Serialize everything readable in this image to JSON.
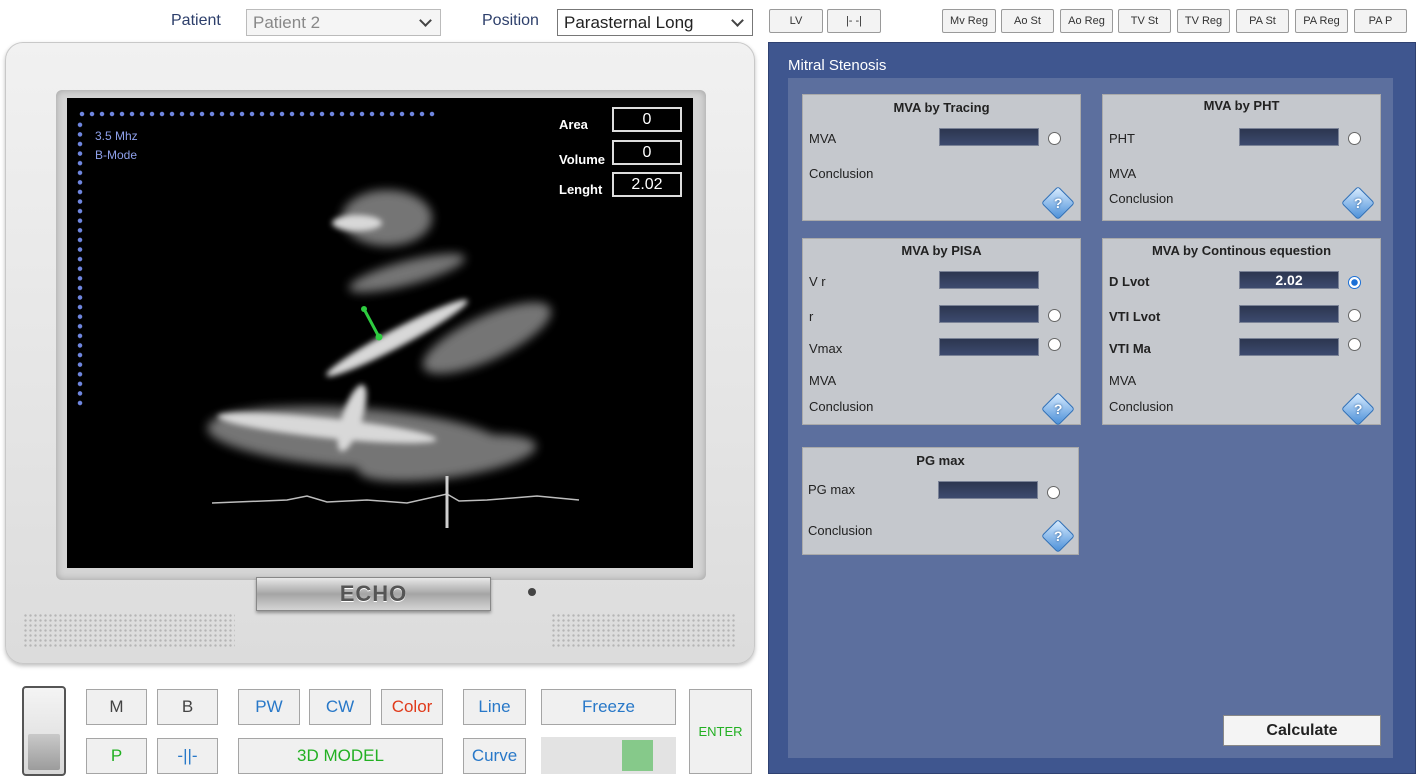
{
  "topbar": {
    "patient_label": "Patient",
    "patient_value": "Patient 2",
    "position_label": "Position",
    "position_value": "Parasternal Long",
    "view_buttons": [
      "LV",
      "|- -|"
    ],
    "mode_buttons": [
      "Mv Reg",
      "Ao St",
      "Ao Reg",
      "TV St",
      "TV Reg",
      "PA St",
      "PA Reg",
      "PA P"
    ]
  },
  "screen": {
    "freq": "3.5 Mhz",
    "mode": "B-Mode",
    "area_label": "Area",
    "area_value": "0",
    "volume_label": "Volume",
    "volume_value": "0",
    "length_label": "Lenght",
    "length_value": "2.02"
  },
  "monitor": {
    "logo": "ECHO"
  },
  "controls": {
    "m": "M",
    "b": "B",
    "pw": "PW",
    "cw": "CW",
    "color": "Color",
    "line": "Line",
    "freeze": "Freeze",
    "p": "P",
    "caliper": "-||-",
    "model3d": "3D MODEL",
    "curve": "Curve",
    "enter": "ENTER",
    "gain_level": 0.8
  },
  "panel": {
    "title": "Mitral Stenosis",
    "tracing": {
      "title": "MVA by Tracing",
      "mva": "MVA",
      "conclusion": "Conclusion"
    },
    "pht": {
      "title": "MVA by PHT",
      "pht": "PHT",
      "mva": "MVA",
      "conclusion": "Conclusion"
    },
    "pisa": {
      "title": "MVA by PISA",
      "vr": "V r",
      "r": "r",
      "vmax": "Vmax",
      "mva": "MVA",
      "conclusion": "Conclusion"
    },
    "continuity": {
      "title": "MVA by Continous equestion",
      "dlvot": "D Lvot",
      "dlvot_value": "2.02",
      "vtilvot": "VTI Lvot",
      "vtima": "VTI Ma",
      "mva": "MVA",
      "conclusion": "Conclusion"
    },
    "pgmax": {
      "title": "PG max",
      "pgmax": "PG max",
      "conclusion": "Conclusion"
    },
    "help_glyph": "?",
    "calculate": "Calculate"
  }
}
